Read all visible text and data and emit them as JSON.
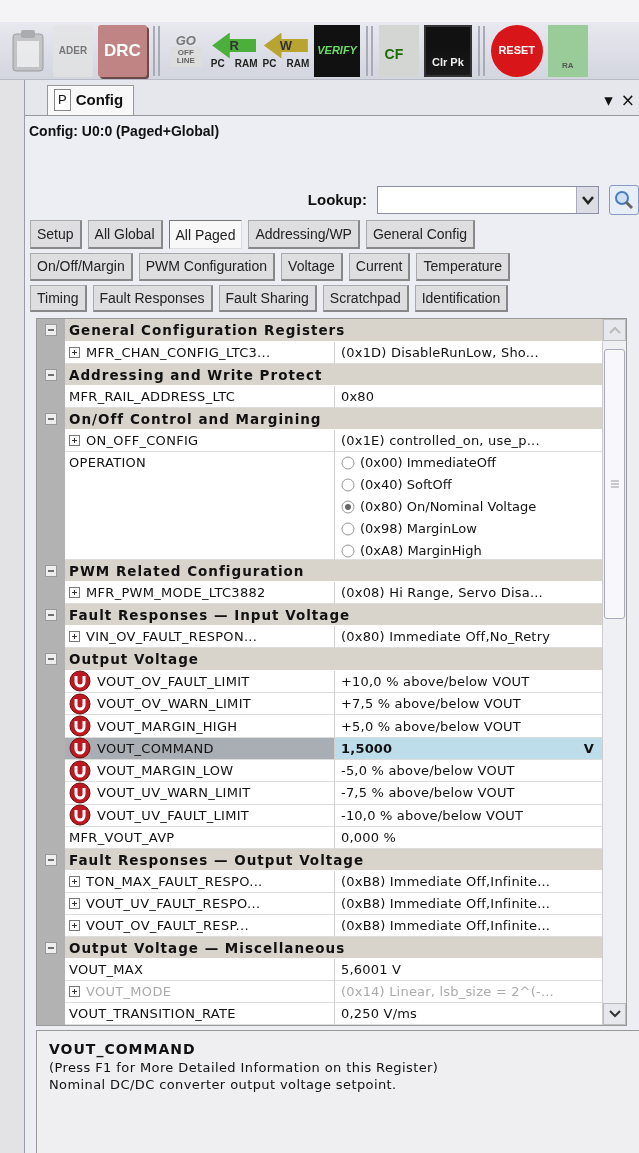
{
  "toolbar": [
    {
      "items": [
        {
          "kind": "clipboard",
          "disabled": true
        },
        {
          "kind": "ader",
          "label": "ADER",
          "disabled": true
        },
        {
          "kind": "drc",
          "label": "DRC",
          "disabled": false
        }
      ]
    },
    {
      "items": [
        {
          "kind": "go",
          "label": "GO",
          "caption": "OFF LINE",
          "disabled": false
        },
        {
          "kind": "read",
          "label": "R",
          "captions": [
            "PC",
            "RAM"
          ],
          "disabled": false
        },
        {
          "kind": "write",
          "label": "W",
          "captions": [
            "PC",
            "RAM"
          ],
          "disabled": false
        },
        {
          "kind": "verify",
          "label": "VERIFY",
          "disabled": false
        }
      ]
    },
    {
      "items": [
        {
          "kind": "cf",
          "label": "CF",
          "disabled": false
        },
        {
          "kind": "clrpk",
          "label": "Clr Pk",
          "disabled": false
        }
      ]
    },
    {
      "items": [
        {
          "kind": "reset",
          "label": "RESET",
          "disabled": false
        },
        {
          "kind": "ram",
          "captions": [
            "RA"
          ],
          "disabled": false
        }
      ]
    }
  ],
  "tabs": [
    {
      "pin": "P",
      "label": "Config",
      "selected": true
    }
  ],
  "tab_menu": "▾",
  "tab_close": "×",
  "config_title": "Config: U0:0 (Paged+Global)",
  "lookup": {
    "label": "Lookup:"
  },
  "category_rows": [
    [
      {
        "label": "Setup",
        "selected": false
      },
      {
        "label": "All Global",
        "selected": false
      },
      {
        "label": "All Paged",
        "selected": true
      },
      {
        "label": "Addressing/WP",
        "selected": false
      },
      {
        "label": "General Config",
        "selected": false
      }
    ],
    [
      {
        "label": "On/Off/Margin",
        "selected": false
      },
      {
        "label": "PWM Configuration",
        "selected": false
      },
      {
        "label": "Voltage",
        "selected": false
      },
      {
        "label": "Current",
        "selected": false
      },
      {
        "label": "Temperature",
        "selected": false
      }
    ],
    [
      {
        "label": "Timing",
        "selected": false
      },
      {
        "label": "Fault Responses",
        "selected": false
      },
      {
        "label": "Fault Sharing",
        "selected": false
      },
      {
        "label": "Scratchpad",
        "selected": false
      },
      {
        "label": "Identification",
        "selected": false
      }
    ]
  ],
  "sections": [
    {
      "title": "General Configuration Registers",
      "expanded": true,
      "rows": [
        {
          "kind": "text",
          "name": "MFR_CHAN_CONFIG_LTC3...",
          "value": "(0x1D)  DisableRunLow, Sho...",
          "expandable": true,
          "flagged": false,
          "selected": false,
          "disabled": false
        }
      ]
    },
    {
      "title": "Addressing and Write Protect",
      "expanded": true,
      "rows": [
        {
          "kind": "text",
          "name": "MFR_RAIL_ADDRESS_LTC",
          "value": "0x80",
          "expandable": false,
          "flagged": false,
          "selected": false,
          "disabled": false
        }
      ]
    },
    {
      "title": "On/Off Control and Margining",
      "expanded": true,
      "rows": [
        {
          "kind": "text",
          "name": "ON_OFF_CONFIG",
          "value": "(0x1E)  controlled_on, use_p...",
          "expandable": true,
          "flagged": false,
          "selected": false,
          "disabled": false
        },
        {
          "kind": "radio",
          "name": "OPERATION",
          "options": [
            {
              "label": "(0x00) ImmediateOff",
              "selected": false
            },
            {
              "label": "(0x40) SoftOff",
              "selected": false
            },
            {
              "label": "(0x80) On/Nominal Voltage",
              "selected": true
            },
            {
              "label": "(0x98) MarginLow",
              "selected": false
            },
            {
              "label": "(0xA8) MarginHigh",
              "selected": false
            }
          ]
        }
      ]
    },
    {
      "title": "PWM Related Configuration",
      "expanded": true,
      "rows": [
        {
          "kind": "text",
          "name": "MFR_PWM_MODE_LTC3882",
          "value": "(0x08) Hi Range, Servo Disa...",
          "expandable": true,
          "flagged": false,
          "selected": false,
          "disabled": false
        }
      ]
    },
    {
      "title": "Fault Responses — Input Voltage",
      "expanded": true,
      "rows": [
        {
          "kind": "text",
          "name": "VIN_OV_FAULT_RESPON...",
          "value": "(0x80) Immediate Off,No_Retry",
          "expandable": true,
          "flagged": false,
          "selected": false,
          "disabled": false
        }
      ]
    },
    {
      "title": "Output Voltage",
      "expanded": true,
      "rows": [
        {
          "kind": "text",
          "name": "VOUT_OV_FAULT_LIMIT",
          "value": "+10,0 % above/below VOUT",
          "expandable": false,
          "flagged": true,
          "selected": false,
          "disabled": false
        },
        {
          "kind": "text",
          "name": "VOUT_OV_WARN_LIMIT",
          "value": "+7,5 % above/below VOUT",
          "expandable": false,
          "flagged": true,
          "selected": false,
          "disabled": false
        },
        {
          "kind": "text",
          "name": "VOUT_MARGIN_HIGH",
          "value": "+5,0 % above/below VOUT",
          "expandable": false,
          "flagged": true,
          "selected": false,
          "disabled": false
        },
        {
          "kind": "text",
          "name": "VOUT_COMMAND",
          "value": "1,5000",
          "unit": "V",
          "expandable": false,
          "flagged": true,
          "selected": true,
          "disabled": false
        },
        {
          "kind": "text",
          "name": "VOUT_MARGIN_LOW",
          "value": "-5,0 % above/below VOUT",
          "expandable": false,
          "flagged": true,
          "selected": false,
          "disabled": false
        },
        {
          "kind": "text",
          "name": "VOUT_UV_WARN_LIMIT",
          "value": "-7,5 % above/below VOUT",
          "expandable": false,
          "flagged": true,
          "selected": false,
          "disabled": false
        },
        {
          "kind": "text",
          "name": "VOUT_UV_FAULT_LIMIT",
          "value": "-10,0 % above/below VOUT",
          "expandable": false,
          "flagged": true,
          "selected": false,
          "disabled": false
        },
        {
          "kind": "text",
          "name": "MFR_VOUT_AVP",
          "value": "0,000 %",
          "expandable": false,
          "flagged": false,
          "selected": false,
          "disabled": false
        }
      ]
    },
    {
      "title": "Fault Responses — Output Voltage",
      "expanded": true,
      "rows": [
        {
          "kind": "text",
          "name": "TON_MAX_FAULT_RESPO...",
          "value": "(0xB8) Immediate Off,Infinite...",
          "expandable": true,
          "flagged": false,
          "selected": false,
          "disabled": false
        },
        {
          "kind": "text",
          "name": "VOUT_UV_FAULT_RESPO...",
          "value": "(0xB8) Immediate Off,Infinite...",
          "expandable": true,
          "flagged": false,
          "selected": false,
          "disabled": false
        },
        {
          "kind": "text",
          "name": "VOUT_OV_FAULT_RESP...",
          "value": "(0xB8) Immediate Off,Infinite...",
          "expandable": true,
          "flagged": false,
          "selected": false,
          "disabled": false
        }
      ]
    },
    {
      "title": "Output Voltage — Miscellaneous",
      "expanded": true,
      "rows": [
        {
          "kind": "text",
          "name": "VOUT_MAX",
          "value": "5,6001 V",
          "expandable": false,
          "flagged": false,
          "selected": false,
          "disabled": false
        },
        {
          "kind": "text",
          "name": "VOUT_MODE",
          "value": "(0x14) Linear, lsb_size = 2^(-...",
          "expandable": true,
          "flagged": false,
          "selected": false,
          "disabled": true
        },
        {
          "kind": "text",
          "name": "VOUT_TRANSITION_RATE",
          "value": "0,250 V/ms",
          "expandable": false,
          "flagged": false,
          "selected": false,
          "disabled": false
        }
      ]
    }
  ],
  "description": {
    "title": "VOUT_COMMAND",
    "lines": [
      "(Press F1 for More Detailed Information on this Register)",
      "Nominal DC/DC converter output voltage setpoint."
    ]
  }
}
